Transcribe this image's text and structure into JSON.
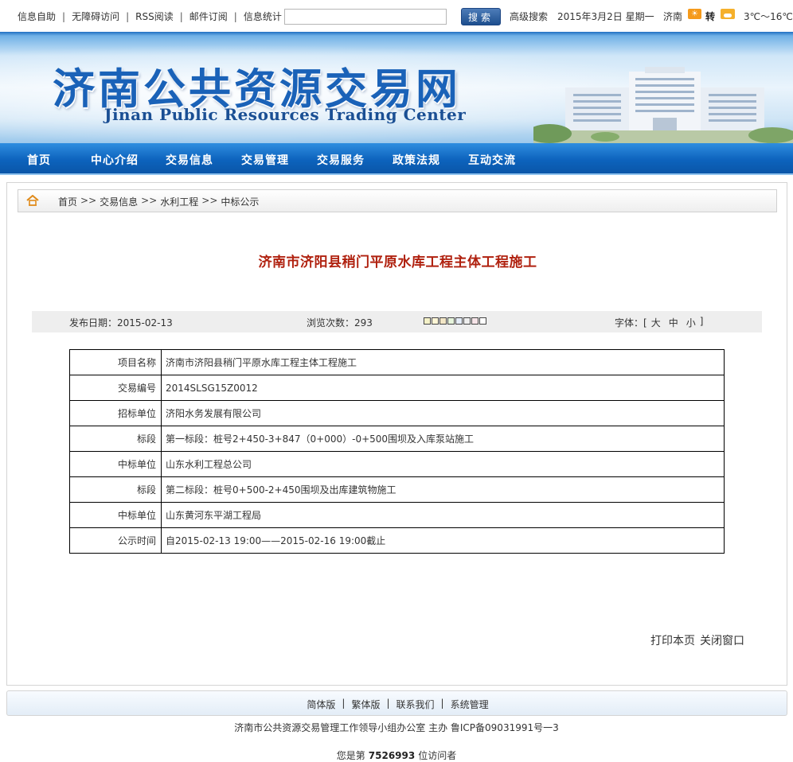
{
  "topbar": {
    "links": [
      "信息自助",
      "无障碍访问",
      "RSS阅读",
      "邮件订阅",
      "信息统计"
    ],
    "separator": "|",
    "search_button": "搜索",
    "advanced_search": "高级搜索",
    "date": "2015年3月2日 星期一",
    "city": "济南",
    "weather_change": "转",
    "temperature": "3℃～16℃"
  },
  "banner": {
    "title": "济南公共资源交易网",
    "subtitle": "Jinan Public Resources Trading Center"
  },
  "nav": {
    "items": [
      "首页",
      "中心介绍",
      "交易信息",
      "交易管理",
      "交易服务",
      "政策法规",
      "互动交流"
    ]
  },
  "breadcrumb": {
    "items": [
      "首页",
      "交易信息",
      "水利工程",
      "中标公示"
    ],
    "separator": ">>"
  },
  "article": {
    "title": "济南市济阳县稍门平原水库工程主体工程施工",
    "pub_date": "发布日期：2015-02-13",
    "views": "浏览次数：293",
    "swatch_colors": [
      "#f4f1c8",
      "#fff6d6",
      "#f2e6c6",
      "#e6f4dc",
      "#e4ecf8",
      "#eeeeee",
      "#f6e4e8",
      "#ffffff"
    ],
    "font_label": "字体：[",
    "font_sizes": [
      "大",
      "中",
      "小"
    ],
    "font_close": "]"
  },
  "table": {
    "rows": [
      {
        "label": "项目名称",
        "value": "济南市济阳县稍门平原水库工程主体工程施工"
      },
      {
        "label": "交易编号",
        "value": "2014SLSG15Z0012"
      },
      {
        "label": "招标单位",
        "value": "济阳水务发展有限公司"
      },
      {
        "label": "标段",
        "value": "第一标段：桩号2+450-3+847（0+000）-0+500围坝及入库泵站施工"
      },
      {
        "label": "中标单位",
        "value": "山东水利工程总公司"
      },
      {
        "label": "标段",
        "value": "第二标段：桩号0+500-2+450围坝及出库建筑物施工"
      },
      {
        "label": "中标单位",
        "value": "山东黄河东平湖工程局"
      },
      {
        "label": "公示时间",
        "value": "自2015-02-13 19:00——2015-02-16 19:00截止"
      }
    ]
  },
  "actions": {
    "print": "打印本页",
    "close": "关闭窗口"
  },
  "footer": {
    "links": [
      "简体版",
      "繁体版",
      "联系我们",
      "系统管理"
    ],
    "separator": "|",
    "org": "济南市公共资源交易管理工作领导小组办公室 主办 鲁ICP备09031991号一3",
    "visitors_prefix": "您是第",
    "visitors_count": "7526993",
    "visitors_suffix": "位访问者"
  }
}
